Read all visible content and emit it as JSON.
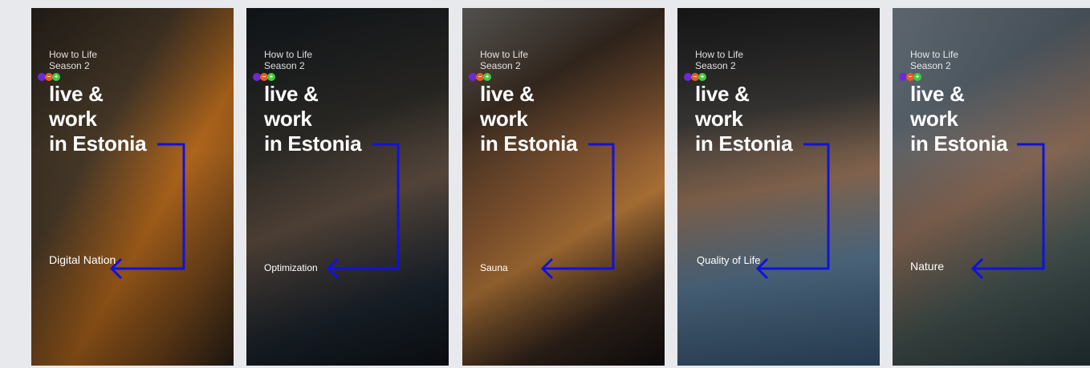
{
  "cards": [
    {
      "series_title": "How to Life",
      "season": "Season 2",
      "headline": [
        "live &",
        "work",
        "in Estonia"
      ],
      "topic": "Digital Nation",
      "bg": "linear-gradient(120deg,#2a241c 0%,#4a3b2a 35%,#b86a1d 60%,#7a4a1c 80%,#2a2218 100%)"
    },
    {
      "series_title": "How to Life",
      "season": "Season 2",
      "headline": [
        "live &",
        "work",
        "in Estonia"
      ],
      "topic": "Optimization",
      "bg": "linear-gradient(160deg,#141a20 0%,#2c2a26 35%,#5a4a3e 55%,#1d2630 80%,#0e141a 100%)"
    },
    {
      "series_title": "How to Life",
      "season": "Season 2",
      "headline": [
        "live &",
        "work",
        "in Estonia"
      ],
      "topic": "Sauna",
      "bg": "linear-gradient(150deg,#6c6a66 0%,#3a2c22 25%,#8c5a32 50%,#b87a3a 62%,#3a2a20 82%,#141010 100%)"
    },
    {
      "series_title": "How to Life",
      "season": "Season 2",
      "headline": [
        "live &",
        "work",
        "in Estonia"
      ],
      "topic": "Quality of Life",
      "bg": "linear-gradient(170deg,#1c1c1e 0%,#3a3836 30%,#8a6a52 50%,#5a7a96 72%,#3a5a7a 100%)"
    },
    {
      "series_title": "How to Life",
      "season": "Season 2",
      "headline": [
        "live &",
        "work",
        "in Estonia"
      ],
      "topic": "Nature",
      "bg": "linear-gradient(150deg,#7a8690 0%,#5a6670 25%,#8a6a56 50%,#4a5a56 72%,#2a3a40 100%)"
    }
  ],
  "colors": {
    "arrow": "#1111dd",
    "dot1": "#6a2ad8",
    "dot2": "#ef5a1f",
    "dot3": "#3ccf3c"
  },
  "icons": [
    "arrow-icon"
  ]
}
